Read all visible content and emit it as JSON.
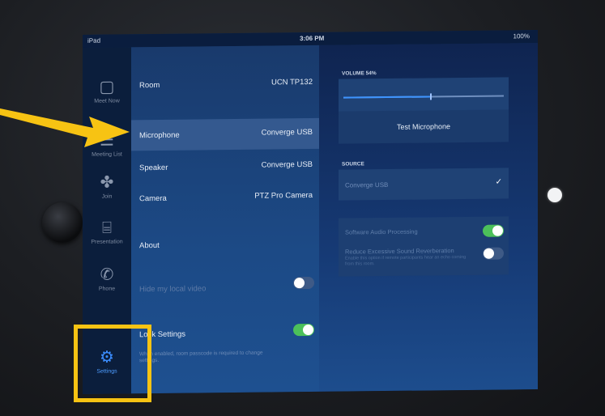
{
  "status_bar": {
    "left": "iPad",
    "time": "3:06 PM",
    "battery": "100%"
  },
  "sidebar": {
    "items": [
      {
        "label": "Meet Now",
        "icon": "meet-now-icon"
      },
      {
        "label": "Meeting List",
        "icon": "meeting-list-icon"
      },
      {
        "label": "Join",
        "icon": "join-icon"
      },
      {
        "label": "Presentation",
        "icon": "presentation-icon"
      },
      {
        "label": "Phone",
        "icon": "phone-icon"
      },
      {
        "label": "Settings",
        "icon": "gear-icon",
        "active": true
      }
    ]
  },
  "settings": {
    "room": {
      "label": "Room",
      "value": "UCN TP132"
    },
    "microphone": {
      "label": "Microphone",
      "value": "Converge USB"
    },
    "speaker": {
      "label": "Speaker",
      "value": "Converge USB"
    },
    "camera": {
      "label": "Camera",
      "value": "PTZ Pro Camera"
    },
    "about": {
      "label": "About"
    },
    "hide_video": {
      "label": "Hide my local video",
      "enabled": false
    },
    "lock_settings": {
      "label": "Lock Settings",
      "enabled": true,
      "note": "When enabled, room passcode is required to change settings."
    }
  },
  "microphone_panel": {
    "volume_caption": "VOLUME 54%",
    "volume_level": 0.54,
    "test_button": "Test Microphone",
    "source_caption": "SOURCE",
    "source_value": "Converge USB",
    "check": "✓",
    "software_audio": {
      "label": "Software Audio Processing",
      "enabled": true
    },
    "reduce_reverb": {
      "label": "Reduce Excessive Sound Reverberation",
      "enabled": false,
      "note": "Enable this option if remote participants hear an echo coming from this room."
    }
  },
  "colors": {
    "highlight": "#f7c313",
    "accent": "#3b8dff",
    "toggle_on": "#4cc15a"
  }
}
